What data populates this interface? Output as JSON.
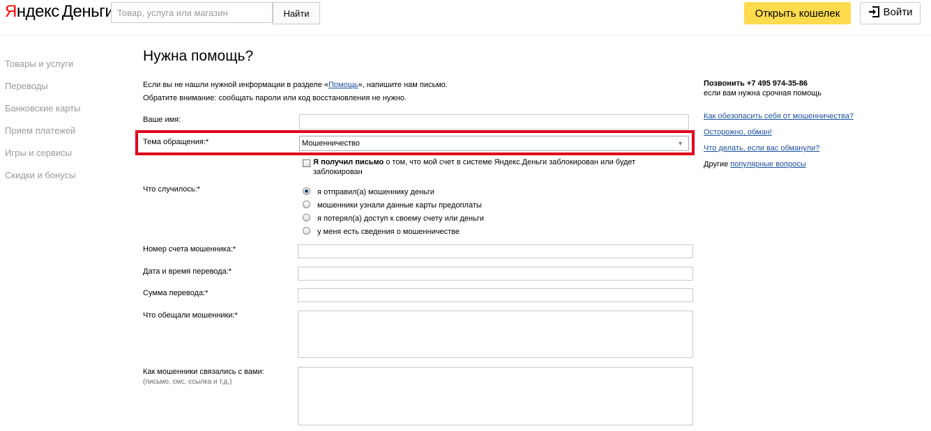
{
  "header": {
    "logo_ya_first": "Я",
    "logo_ya_rest": "ндекс",
    "logo_money": "Деньги",
    "search_placeholder": "Товар, услуга или магазин",
    "search_button": "Найти",
    "open_wallet": "Открыть кошелек",
    "login": "Войти"
  },
  "sidebar": {
    "items": [
      "Товары и услуги",
      "Переводы",
      "Банковские карты",
      "Прием платежей",
      "Игры и сервисы",
      "Скидки и бонусы"
    ]
  },
  "main": {
    "title": "Нужна помощь?",
    "intro_part1": "Если вы не нашли нужной информации в разделе «",
    "intro_link": "Помощь",
    "intro_part2": "», напишите нам письмо.",
    "intro_line2": "Обратите внимание: сообщать пароли или код восстановления не нужно.",
    "name_label": "Ваше имя:",
    "name_value": "",
    "topic_label": "Тема обращения:*",
    "topic_value": "Мошенничество",
    "letter_bold": "Я получил письмо",
    "letter_rest": " о том, что мой счет в системе Яндекс.Деньги заблокирован или будет заблокирован",
    "what_label": "Что случилось:*",
    "radio_options": [
      "я отправил(а) мошеннику деньги",
      "мошенники узнали данные карты предоплаты",
      "я потерял(а) доступ к своему счету или деньги",
      "у меня есть сведения о мошенничестве"
    ],
    "radio_selected": 0,
    "account_label": "Номер счета мошенника:*",
    "datetime_label": "Дата и время перевода:*",
    "sum_label": "Сумма перевода:*",
    "promise_label": "Что обещали мошенники:*",
    "contact_label": "Как мошенники связались с вами:",
    "contact_hint": "(письмо, смс, ссылка и т.д.)"
  },
  "right": {
    "phone": "Позвонить +7 495 974-35-86",
    "phone_note": "если вам нужна срочная помощь",
    "links": [
      "Как обезопасить себя от мошенничества?",
      "Осторожно, обман!",
      "Что делать, если вас обманули?"
    ],
    "other_prefix": "Другие ",
    "other_link": "популярные вопросы"
  }
}
